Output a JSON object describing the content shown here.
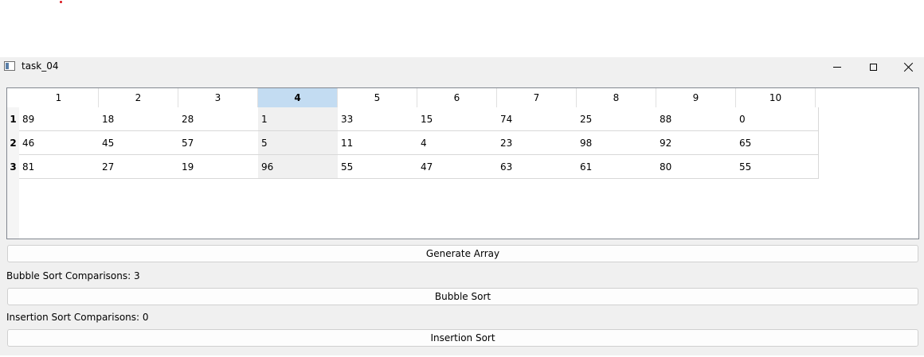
{
  "window": {
    "title": "task_04"
  },
  "titlebar_icons": {
    "app": "app-window-icon",
    "minimize": "minimize-icon",
    "maximize": "maximize-icon",
    "close": "close-icon"
  },
  "table": {
    "column_headers": [
      "1",
      "2",
      "3",
      "4",
      "5",
      "6",
      "7",
      "8",
      "9",
      "10"
    ],
    "row_headers": [
      "1",
      "2",
      "3"
    ],
    "selected_column": "4",
    "rows": [
      [
        "89",
        "18",
        "28",
        "1",
        "33",
        "15",
        "74",
        "25",
        "88",
        "0"
      ],
      [
        "46",
        "45",
        "57",
        "5",
        "11",
        "4",
        "23",
        "98",
        "92",
        "65"
      ],
      [
        "81",
        "27",
        "19",
        "96",
        "55",
        "47",
        "63",
        "61",
        "80",
        "55"
      ]
    ]
  },
  "controls": {
    "generate_label": "Generate Array",
    "bubble_count_text": "Bubble Sort Comparisons: 3",
    "bubble_label": "Bubble Sort",
    "insertion_count_text": "Insertion Sort Comparisons: 0",
    "insertion_label": "Insertion Sort"
  },
  "colors": {
    "selected_header": "#c3dcf2",
    "selected_cell": "#f0f0f0",
    "window_bg": "#f0f0f0"
  }
}
